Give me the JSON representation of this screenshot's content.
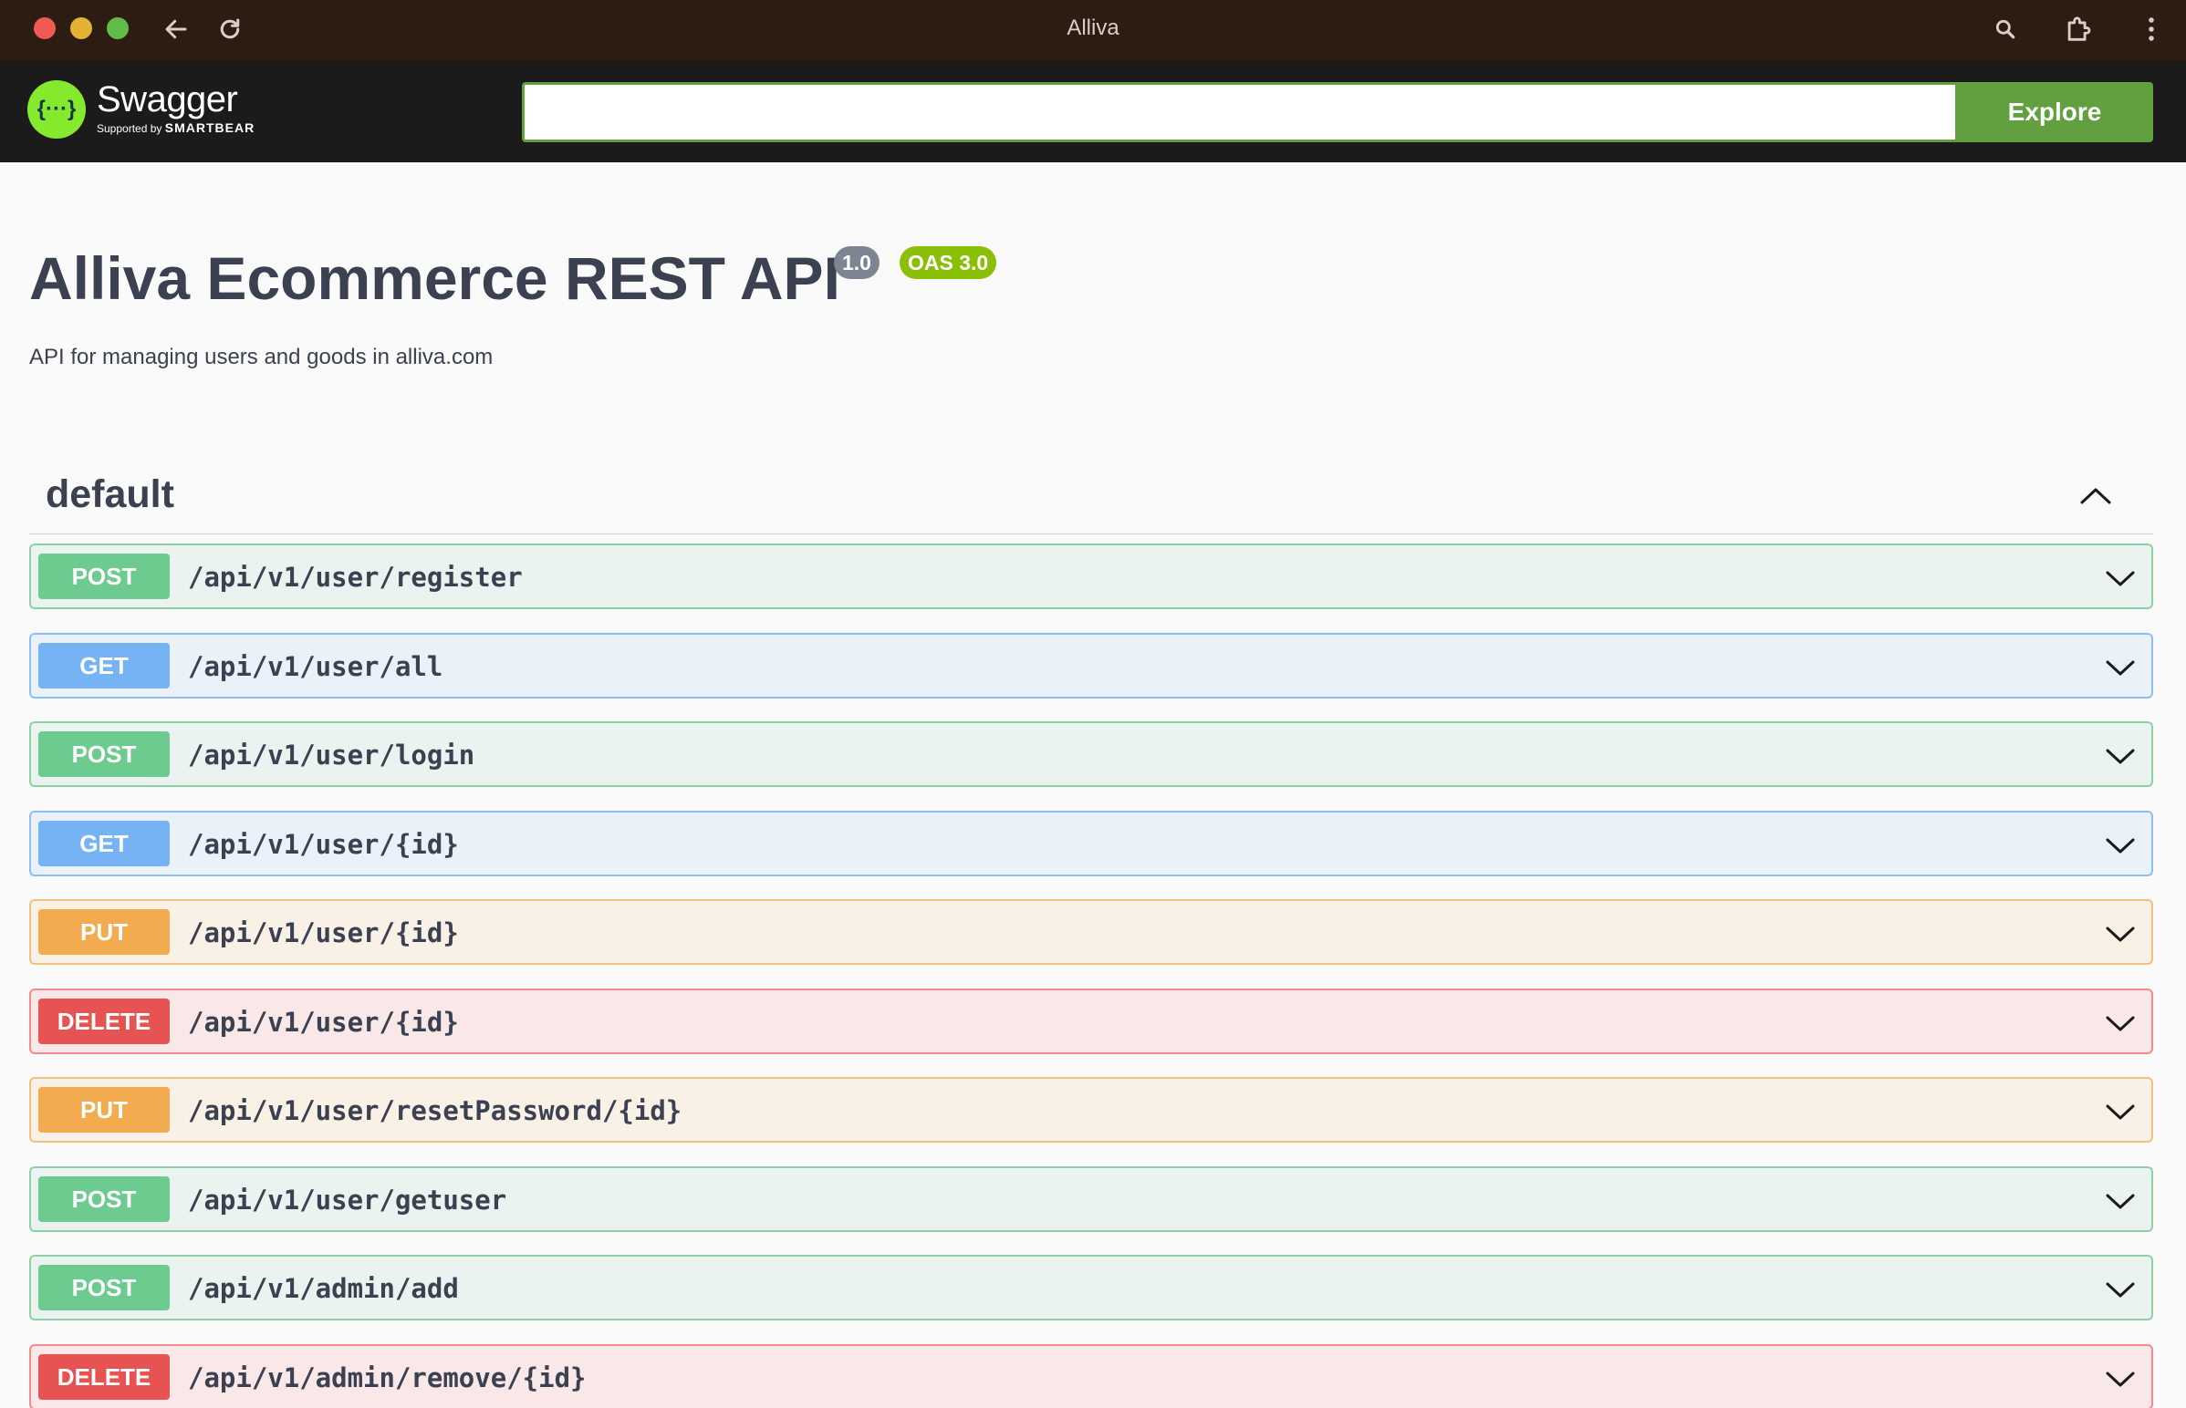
{
  "browser": {
    "title": "Alliva"
  },
  "topbar": {
    "logo_name": "Swagger",
    "logo_supported": "Supported by",
    "logo_brand": "SMARTBEAR",
    "search_value": "",
    "explore_label": "Explore"
  },
  "info": {
    "title": "Alliva Ecommerce REST API",
    "version": "1.0",
    "oas": "OAS 3.0",
    "description": "API for managing users and goods in alliva.com"
  },
  "section": {
    "name": "default"
  },
  "operations": [
    {
      "method": "POST",
      "path": "/api/v1/user/register"
    },
    {
      "method": "GET",
      "path": "/api/v1/user/all"
    },
    {
      "method": "POST",
      "path": "/api/v1/user/login"
    },
    {
      "method": "GET",
      "path": "/api/v1/user/{id}"
    },
    {
      "method": "PUT",
      "path": "/api/v1/user/{id}"
    },
    {
      "method": "DELETE",
      "path": "/api/v1/user/{id}"
    },
    {
      "method": "PUT",
      "path": "/api/v1/user/resetPassword/{id}"
    },
    {
      "method": "POST",
      "path": "/api/v1/user/getuser"
    },
    {
      "method": "POST",
      "path": "/api/v1/admin/add"
    },
    {
      "method": "DELETE",
      "path": "/api/v1/admin/remove/{id}"
    }
  ],
  "colors": {
    "post": "#49cc90",
    "get": "#61affe",
    "put": "#fca130",
    "delete": "#f93e3e",
    "swagger_green": "#85ea2d",
    "explore": "#62a03f"
  }
}
